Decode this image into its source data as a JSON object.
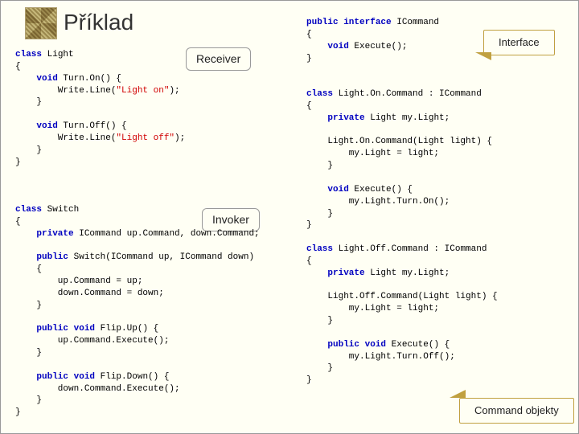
{
  "slide": {
    "title": "Příklad",
    "callouts": {
      "receiver": "Receiver",
      "invoker": "Invoker",
      "interface": "Interface",
      "cmdobj": "Command objekty"
    }
  },
  "code": {
    "left": {
      "l01a": "class",
      "l01b": " Light",
      "l02": "{",
      "l03a": "    void",
      "l03b": " Turn.On() {",
      "l04a": "        Write.Line(",
      "l04b": "\"Light on\"",
      "l04c": ");",
      "l05": "    }",
      "l06": "",
      "l07a": "    void",
      "l07b": " Turn.Off() {",
      "l08a": "        Write.Line(",
      "l08b": "\"Light off\"",
      "l08c": ");",
      "l09": "    }",
      "l10": "}",
      "s01a": "class",
      "s01b": " Switch",
      "s02": "{",
      "s03a": "    private",
      "s03b": " ICommand up.Command, down.Command;",
      "s04": "",
      "s05a": "    public",
      "s05b": " Switch(ICommand up, ICommand down)",
      "s06": "    {",
      "s07": "        up.Command = up;",
      "s08": "        down.Command = down;",
      "s09": "    }",
      "s10": "",
      "s11a": "    public void",
      "s11b": " Flip.Up() {",
      "s12": "        up.Command.Execute();",
      "s13": "    }",
      "s14": "",
      "s15a": "    public void",
      "s15b": " Flip.Down() {",
      "s16": "        down.Command.Execute();",
      "s17": "    }",
      "s18": "}"
    },
    "right": {
      "i01a": "public interface",
      "i01b": " ICommand",
      "i02": "{",
      "i03a": "    void",
      "i03b": " Execute();",
      "i04": "}",
      "on01a": "class",
      "on01b": " Light.On.Command : ICommand",
      "on02": "{",
      "on03a": "    private",
      "on03b": " Light my.Light;",
      "on04": "",
      "on05": "    Light.On.Command(Light light) {",
      "on06": "        my.Light = light;",
      "on07": "    }",
      "on08": "",
      "on09a": "    void",
      "on09b": " Execute() {",
      "on10": "        my.Light.Turn.On();",
      "on11": "    }",
      "on12": "}",
      "of01a": "class",
      "of01b": " Light.Off.Command : ICommand",
      "of02": "{",
      "of03a": "    private",
      "of03b": " Light my.Light;",
      "of04": "",
      "of05": "    Light.Off.Command(Light light) {",
      "of06": "        my.Light = light;",
      "of07": "    }",
      "of08": "",
      "of09a": "    public void",
      "of09b": " Execute() {",
      "of10": "        my.Light.Turn.Off();",
      "of11": "    }",
      "of12": "}"
    }
  }
}
